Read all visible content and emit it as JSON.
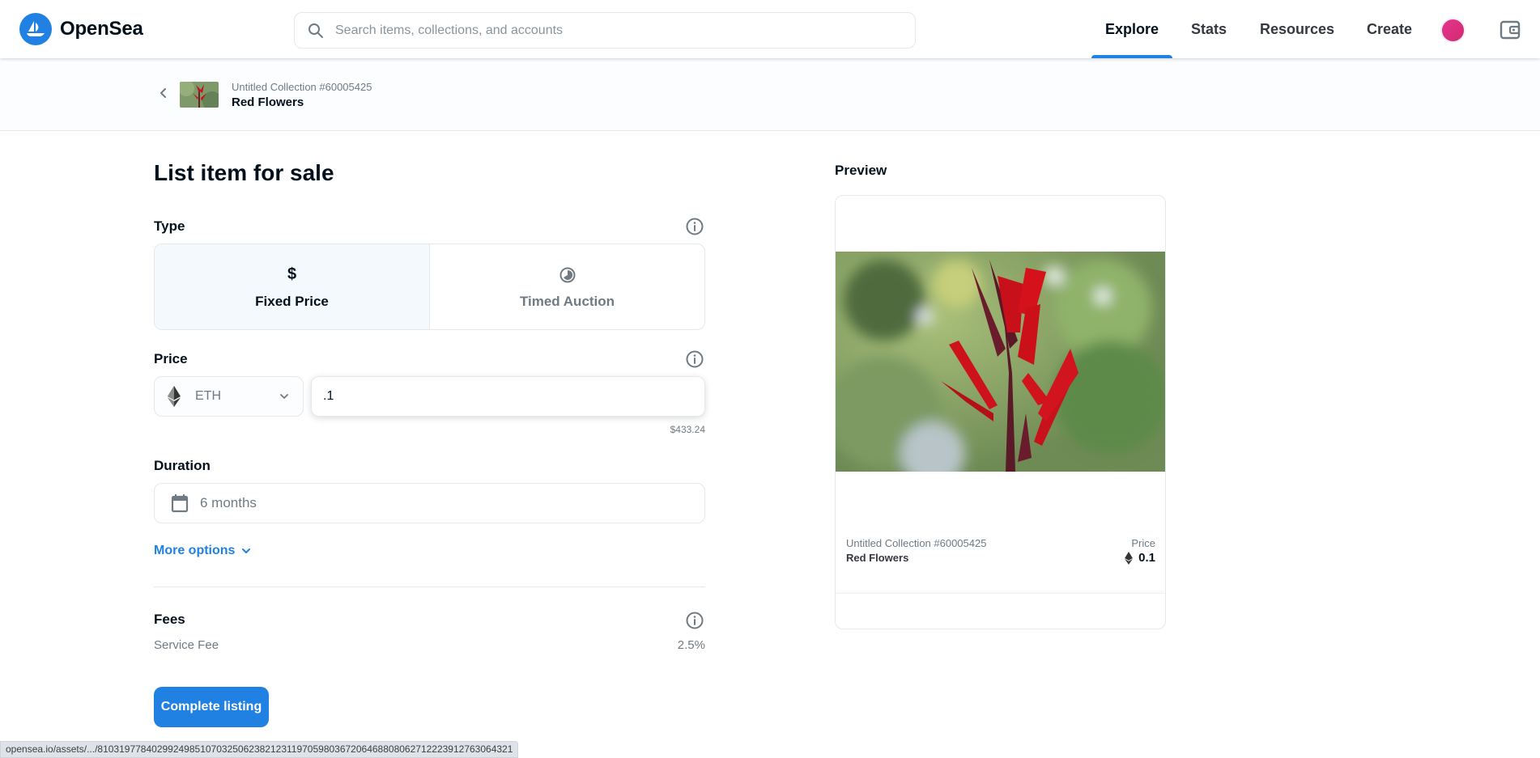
{
  "header": {
    "brand": "OpenSea",
    "search_placeholder": "Search items, collections, and accounts",
    "search_value": "",
    "nav": [
      {
        "label": "Explore",
        "active": true
      },
      {
        "label": "Stats",
        "active": false
      },
      {
        "label": "Resources",
        "active": false
      },
      {
        "label": "Create",
        "active": false
      }
    ],
    "icons": {
      "logo": "opensea-ship-icon",
      "search": "search-icon",
      "avatar": "profile-avatar",
      "wallet": "wallet-icon"
    },
    "colors": {
      "accent": "#2081e2",
      "avatar": "#e63691"
    }
  },
  "breadcrumb": {
    "collection": "Untitled Collection #60005425",
    "item_name": "Red Flowers"
  },
  "form": {
    "title": "List item for sale",
    "type": {
      "label": "Type",
      "options": [
        {
          "label": "Fixed Price",
          "icon": "$",
          "selected": true
        },
        {
          "label": "Timed Auction",
          "icon": "clock",
          "selected": false
        }
      ]
    },
    "price": {
      "label": "Price",
      "currency": "ETH",
      "value": ".1",
      "usd_value": "$433.24"
    },
    "duration": {
      "label": "Duration",
      "value": "6 months"
    },
    "more_options": "More options",
    "fees": {
      "label": "Fees",
      "service_fee_label": "Service Fee",
      "service_fee_value": "2.5%"
    },
    "submit_label": "Complete listing"
  },
  "preview": {
    "label": "Preview",
    "collection": "Untitled Collection #60005425",
    "name": "Red Flowers",
    "price_label": "Price",
    "price_value": "0.1"
  },
  "status_bar": {
    "url": "opensea.io/assets/.../81031977840299249851070325062382123119705980367206468808062712223912763064321"
  }
}
